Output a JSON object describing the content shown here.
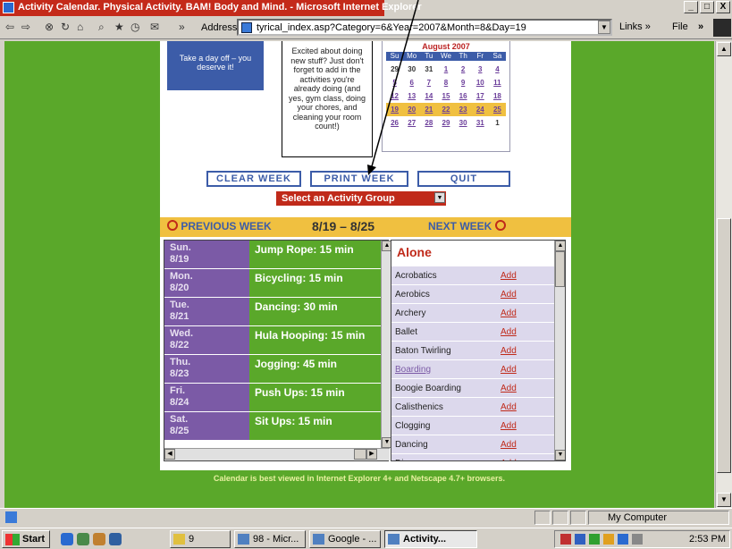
{
  "window": {
    "title": "Activity Calendar. Physical Activity. BAM! Body and Mind. - Microsoft Internet Explorer",
    "buttons": [
      "_",
      "□",
      "X"
    ]
  },
  "toolbar": {
    "address_label": "Address",
    "url": "tyrical_index.asp?Category=6&Year=2007&Month=8&Day=19",
    "links_label": "Links »",
    "file_label": "File",
    "more_label": "»"
  },
  "tips": {
    "tip1": "Take a day off – you deserve it!",
    "tip2": "Excited about doing new stuff? Just don't forget to add in the activities you're already doing (and yes, gym class, doing your chores, and cleaning your room count!)"
  },
  "calendar": {
    "title": "August 2007",
    "dow": [
      "Su",
      "Mo",
      "Tu",
      "We",
      "Th",
      "Fr",
      "Sa"
    ],
    "weeks": [
      [
        "29",
        "30",
        "31",
        "1",
        "2",
        "3",
        "4"
      ],
      [
        "5",
        "6",
        "7",
        "8",
        "9",
        "10",
        "11"
      ],
      [
        "12",
        "13",
        "14",
        "15",
        "16",
        "17",
        "18"
      ],
      [
        "19",
        "20",
        "21",
        "22",
        "23",
        "24",
        "25"
      ],
      [
        "26",
        "27",
        "28",
        "29",
        "30",
        "31",
        "1"
      ]
    ]
  },
  "buttons": {
    "clear_week": "CLEAR WEEK",
    "print_week": "PRINT WEEK",
    "quit": "QUIT",
    "select_group": "Select an Activity Group"
  },
  "weeknav": {
    "prev": "PREVIOUS WEEK",
    "range": "8/19 – 8/25",
    "next": "NEXT WEEK"
  },
  "schedule": [
    {
      "day": "Sun.",
      "date": "8/19",
      "activity": "Jump Rope: 15 min"
    },
    {
      "day": "Mon.",
      "date": "8/20",
      "activity": "Bicycling: 15 min"
    },
    {
      "day": "Tue.",
      "date": "8/21",
      "activity": "Dancing: 30 min"
    },
    {
      "day": "Wed.",
      "date": "8/22",
      "activity": "Hula Hooping: 15 min"
    },
    {
      "day": "Thu.",
      "date": "8/23",
      "activity": "Jogging: 45 min"
    },
    {
      "day": "Fri.",
      "date": "8/24",
      "activity": "Push Ups: 15 min"
    },
    {
      "day": "Sat.",
      "date": "8/25",
      "activity": "Sit Ups: 15 min"
    }
  ],
  "activity_group": {
    "title": "Alone",
    "add_label": "Add",
    "items": [
      "Acrobatics",
      "Aerobics",
      "Archery",
      "Ballet",
      "Baton Twirling",
      "Boarding",
      "Boogie Boarding",
      "Calisthenics",
      "Clogging",
      "Dancing",
      "Discus"
    ]
  },
  "footer_note": "Calendar is best viewed in Internet Explorer 4+ and Netscape 4.7+ browsers.",
  "status": {
    "zone": "My Computer"
  },
  "taskbar": {
    "start": "Start",
    "tasks": [
      "9",
      "98 - Micr...",
      "Google - ...",
      "Activity..."
    ],
    "clock": "2:53 PM"
  }
}
